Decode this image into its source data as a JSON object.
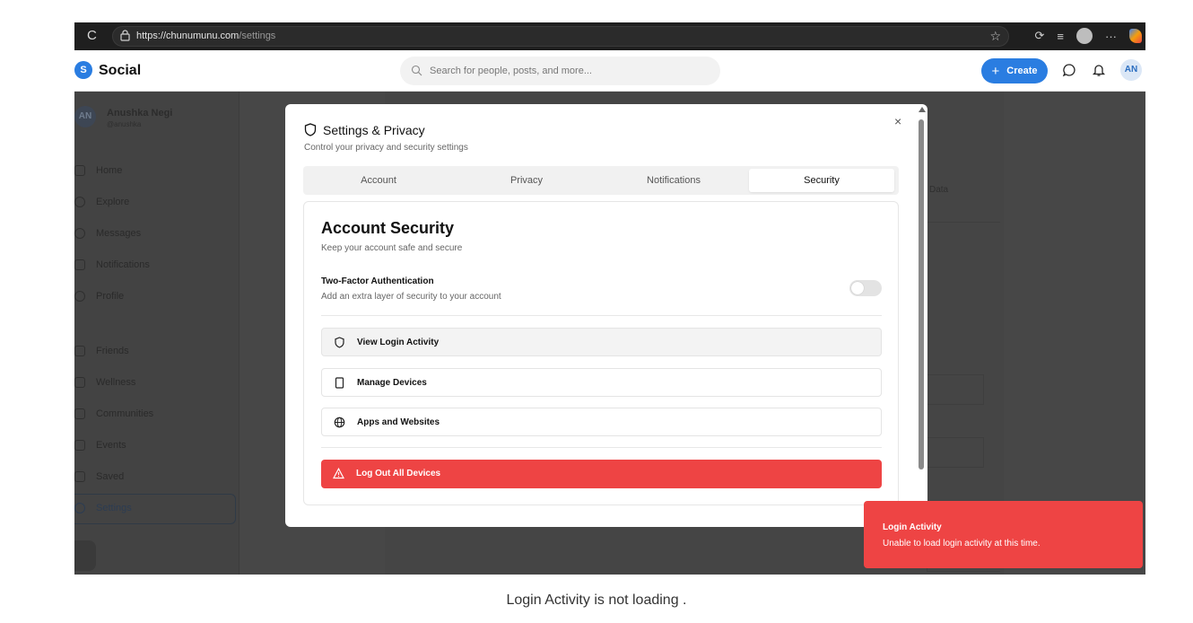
{
  "browser": {
    "url_host": "https://chunumunu.com",
    "url_path": "/settings"
  },
  "app": {
    "logo_letter": "S",
    "name": "Social",
    "search_placeholder": "Search for people, posts, and more...",
    "create_label": "Create",
    "avatar_initials": "AN"
  },
  "sidebar": {
    "user_initials": "AN",
    "user_name": "Anushka Negi",
    "user_handle": "@anushka",
    "items": [
      {
        "label": "Home",
        "icon": "home-icon"
      },
      {
        "label": "Explore",
        "icon": "search-icon"
      },
      {
        "label": "Messages",
        "icon": "message-icon"
      },
      {
        "label": "Notifications",
        "icon": "heart-icon"
      },
      {
        "label": "Profile",
        "icon": "user-icon"
      },
      {
        "label": "Friends",
        "icon": "users-icon"
      },
      {
        "label": "Wellness",
        "icon": "activity-icon"
      },
      {
        "label": "Communities",
        "icon": "communities-icon"
      },
      {
        "label": "Events",
        "icon": "calendar-icon"
      },
      {
        "label": "Saved",
        "icon": "bookmark-icon"
      },
      {
        "label": "Settings",
        "icon": "gear-icon"
      }
    ]
  },
  "background": {
    "data_label": "Data"
  },
  "modal": {
    "title": "Settings & Privacy",
    "subtitle": "Control your privacy and security settings",
    "close_label": "×",
    "tabs": [
      {
        "label": "Account"
      },
      {
        "label": "Privacy"
      },
      {
        "label": "Notifications"
      },
      {
        "label": "Security",
        "active": true
      }
    ],
    "security": {
      "title": "Account Security",
      "subtitle": "Keep your account safe and secure",
      "tfa_title": "Two-Factor Authentication",
      "tfa_subtitle": "Add an extra layer of security to your account",
      "tfa_enabled": false,
      "options": [
        {
          "label": "View Login Activity",
          "icon": "shield-icon"
        },
        {
          "label": "Manage Devices",
          "icon": "device-icon"
        },
        {
          "label": "Apps and Websites",
          "icon": "globe-icon"
        }
      ],
      "logout_label": "Log Out All Devices"
    }
  },
  "toast": {
    "title": "Login Activity",
    "message": "Unable to load login activity at this time."
  },
  "caption": "Login Activity is not loading ."
}
